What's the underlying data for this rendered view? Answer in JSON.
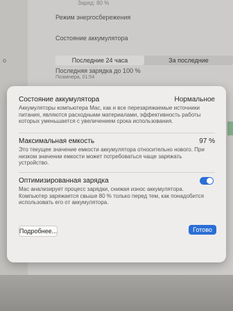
{
  "background": {
    "top_partial": "Заряд: 80 %",
    "low_power_mode": "Режим энергосбережения",
    "battery_health": "Состояние аккумулятора",
    "sidebar_partial": "о",
    "tabs": [
      "Последние 24 часа",
      "За последние"
    ],
    "last_charge": "Последняя зарядка до 100 %",
    "last_charge_time": "Позавчера, 01:54"
  },
  "sheet": {
    "health": {
      "title": "Состояние аккумулятора",
      "value": "Нормальное",
      "description": "Аккумуляторы компьютера Mac, как и все перезаряжаемые источники питания, являются расходными материалами, эффективность работы которых уменьшается с увеличением срока использования."
    },
    "capacity": {
      "title": "Максимальная емкость",
      "value": "97 %",
      "description": "Это текущее значение емкости аккумулятора относительно нового. При низком значении емкости может потребоваться чаще заряжать устройство."
    },
    "optimized": {
      "title": "Оптимизированная зарядка",
      "enabled": true,
      "description": "Mac анализирует процесс зарядки, снижая износ аккумулятора. Компьютер заряжается свыше 80 % только перед тем, как понадобится использовать его от аккумулятора."
    },
    "buttons": {
      "more": "Подробнее...",
      "done": "Готово"
    }
  },
  "colors": {
    "accent": "#2a6fd6",
    "sheet_bg": "#efedeb"
  }
}
